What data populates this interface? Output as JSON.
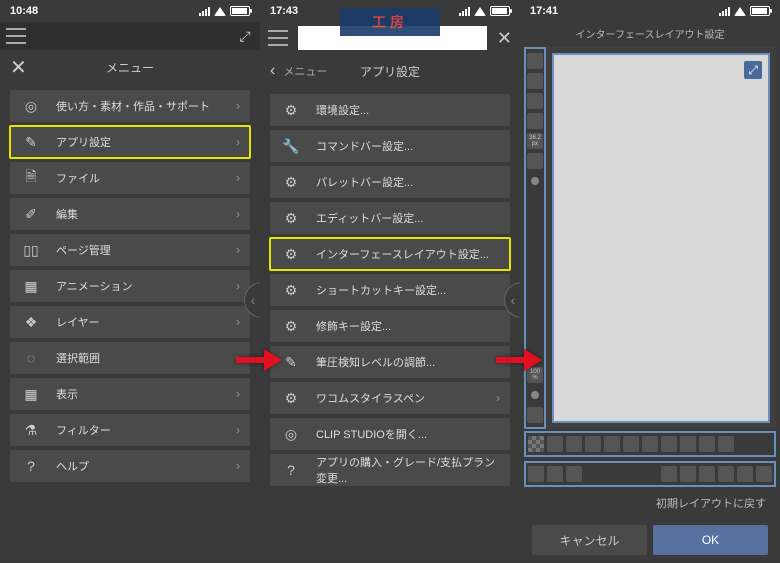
{
  "panel1": {
    "time": "10:48",
    "title": "メニュー",
    "items": [
      {
        "label": "使い方・素材・作品・サポート",
        "chev": true
      },
      {
        "label": "アプリ設定",
        "chev": true,
        "highlight": true
      },
      {
        "label": "ファイル",
        "chev": true
      },
      {
        "label": "編集",
        "chev": true
      },
      {
        "label": "ページ管理",
        "chev": true
      },
      {
        "label": "アニメーション",
        "chev": true
      },
      {
        "label": "レイヤー",
        "chev": true
      },
      {
        "label": "選択範囲",
        "chev": true
      },
      {
        "label": "表示",
        "chev": true
      },
      {
        "label": "フィルター",
        "chev": true
      },
      {
        "label": "ヘルプ",
        "chev": true
      }
    ]
  },
  "panel2": {
    "time": "17:43",
    "back": "メニュー",
    "title": "アプリ設定",
    "items": [
      {
        "label": "環境設定..."
      },
      {
        "label": "コマンドバー設定..."
      },
      {
        "label": "パレットバー設定..."
      },
      {
        "label": "エディットバー設定..."
      },
      {
        "label": "インターフェースレイアウト設定...",
        "highlight": true
      },
      {
        "label": "ショートカットキー設定..."
      },
      {
        "label": "修飾キー設定..."
      },
      {
        "label": "筆圧検知レベルの調節..."
      },
      {
        "label": "ワコムスタイラスペン",
        "chev": true
      },
      {
        "label": "CLIP STUDIOを開く..."
      },
      {
        "label": "アプリの購入・グレード/支払プラン変更..."
      }
    ]
  },
  "panel3": {
    "time": "17:41",
    "title": "インターフェースレイアウト設定",
    "zoom_badge": "36.2 px",
    "pct_badge": "100 %",
    "reset": "初期レイアウトに戻す",
    "cancel": "キャンセル",
    "ok": "OK"
  },
  "watermark": "工房"
}
